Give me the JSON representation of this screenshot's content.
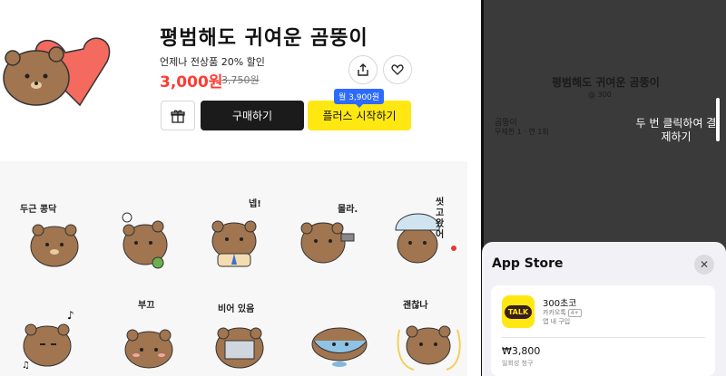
{
  "product": {
    "title": "평범해도 귀여운 곰뚱이",
    "promo": "언제나 전상품 20% 할인",
    "price": "3,000원",
    "original_price": "3,750원"
  },
  "actions": {
    "buy_label": "구매하기",
    "plus_label": "플러스 시작하기",
    "monthly_badge": "월 3,900원"
  },
  "stickers": [
    {
      "caption": "두근 콩닥"
    },
    {
      "caption": ""
    },
    {
      "caption": "넵!"
    },
    {
      "caption": "몰라."
    },
    {
      "caption": "씻고왔어"
    },
    {
      "caption": ""
    },
    {
      "caption": "부끄"
    },
    {
      "caption": "비어 있음"
    },
    {
      "caption": ""
    },
    {
      "caption": "괜찮나"
    }
  ],
  "phone": {
    "dim_title": "평범해도 귀여운 곰뚱이",
    "dim_sub": "@ 300",
    "dim_row1": "곰뚱이",
    "dim_row2": "무제한 1 · 연 1회",
    "double_click": "두 번 클릭하여 결제하기",
    "sheet_title": "App Store",
    "app_badge": "TALK",
    "item_name": "300초코",
    "item_app": "카카오톡",
    "age": "4+",
    "item_type": "앱 내 구입",
    "pay_price": "₩3,800",
    "pay_desc": "일회성 청구"
  },
  "colors": {
    "price_red": "#ff3b30",
    "kakao_yellow": "#ffe812",
    "badge_blue": "#2d6bff",
    "bear_brown": "#a0754f"
  }
}
